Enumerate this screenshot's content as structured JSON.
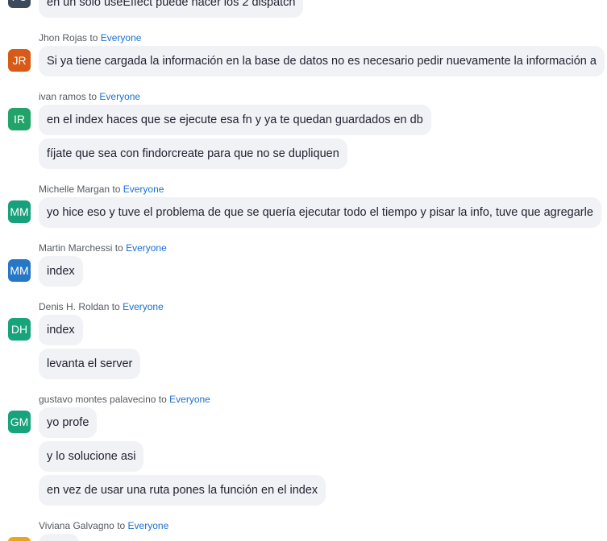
{
  "to_word": "to",
  "target": "Everyone",
  "messages": [
    {
      "sender": "",
      "initials": "FC",
      "color": "#3b4a5c",
      "bubbles": [
        "en un solo useEffect puede hacer los 2 dispatch"
      ]
    },
    {
      "sender": "Jhon Rojas",
      "initials": "JR",
      "color": "#d85a17",
      "bubbles": [
        "Si ya tiene cargada la información en la base de datos no es necesario pedir nuevamente la información a"
      ]
    },
    {
      "sender": "ivan ramos",
      "initials": "IR",
      "color": "#22a36a",
      "bubbles": [
        "en el index haces que se ejecute esa fn y ya te quedan guardados en db",
        "fíjate que sea con findorcreate para que no se dupliquen"
      ]
    },
    {
      "sender": "Michelle Margan",
      "initials": "MM",
      "color": "#18a07c",
      "bubbles": [
        "yo hice eso y tuve el problema de que se quería ejecutar todo el tiempo y pisar la info, tuve que agregarle"
      ]
    },
    {
      "sender": "Martin Marchessi",
      "initials": "MM",
      "color": "#2677c7",
      "bubbles": [
        "index"
      ]
    },
    {
      "sender": "Denis H. Roldan",
      "initials": "DH",
      "color": "#17a37c",
      "bubbles": [
        "index",
        "levanta el server"
      ]
    },
    {
      "sender": "gustavo montes palavecino",
      "initials": "GM",
      "color": "#17a37c",
      "bubbles": [
        "yo profe",
        "y lo solucione asi",
        "en vez de usar una ruta pones la función en el index"
      ]
    },
    {
      "sender": "Viviana Galvagno",
      "initials": "",
      "color": "#f0a21a",
      "bubbles": [
        ""
      ]
    }
  ]
}
